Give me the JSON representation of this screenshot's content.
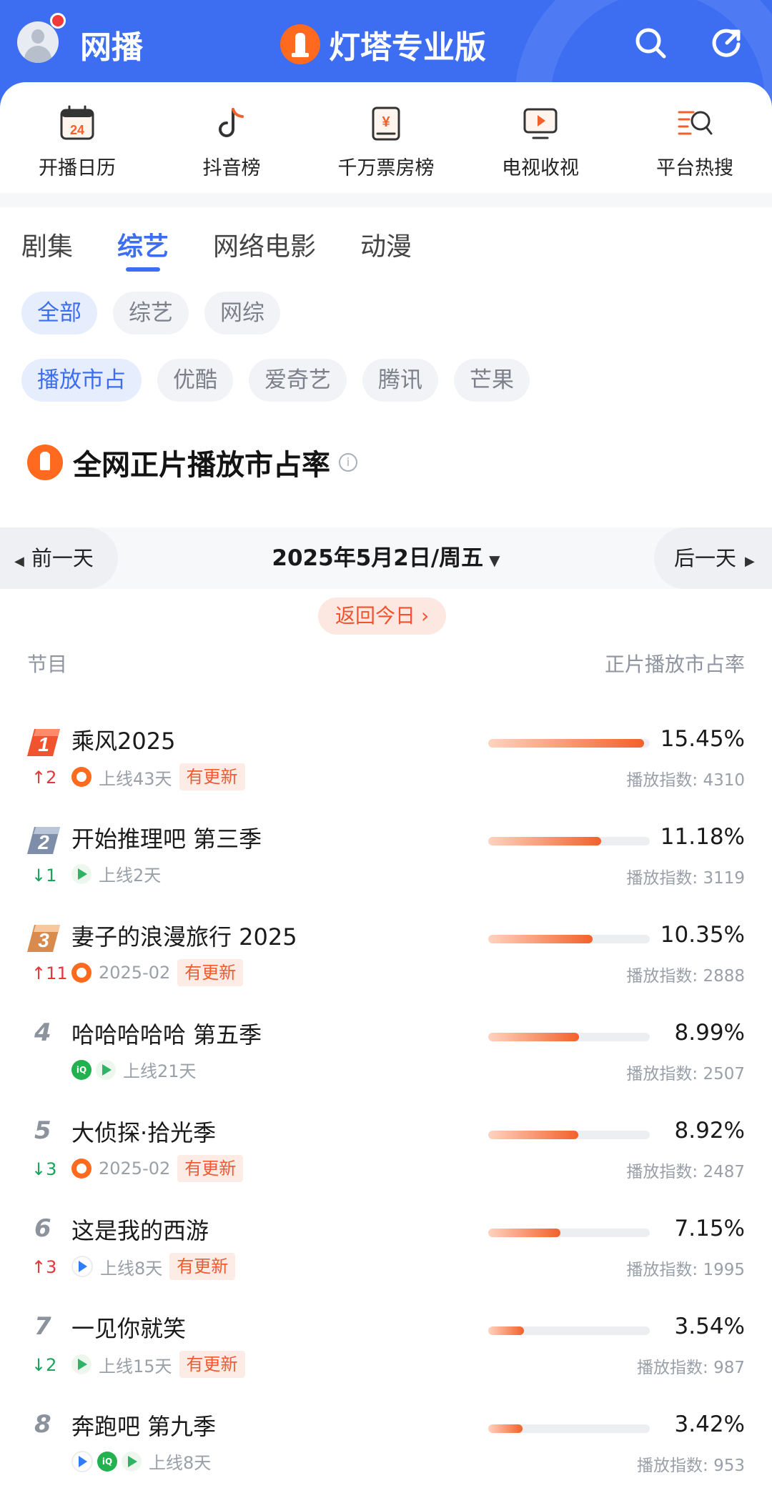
{
  "header": {
    "left_title": "网播",
    "app_name": "灯塔专业版",
    "icons": [
      "search-icon",
      "refresh-icon"
    ]
  },
  "quick_nav": [
    {
      "label": "开播日历",
      "icon": "calendar-icon",
      "day": "24"
    },
    {
      "label": "抖音榜",
      "icon": "tiktok-icon"
    },
    {
      "label": "千万票房榜",
      "icon": "ticket-icon",
      "symbol": "¥"
    },
    {
      "label": "电视收视",
      "icon": "tv-icon"
    },
    {
      "label": "平台热搜",
      "icon": "hot-search-icon"
    }
  ],
  "tabs": [
    "剧集",
    "综艺",
    "网络电影",
    "动漫"
  ],
  "active_tab": "综艺",
  "type_filters": [
    "全部",
    "综艺",
    "网综"
  ],
  "platform_filters": [
    "播放市占",
    "优酷",
    "爱奇艺",
    "腾讯",
    "芒果"
  ],
  "section": {
    "title": "全网正片播放市占率"
  },
  "date_nav": {
    "prev": "前一天",
    "date": "2025年5月2日/周五",
    "next": "后一天",
    "today": "返回今日"
  },
  "columns": {
    "program": "节目",
    "share": "正片播放市占率"
  },
  "colors": {
    "accent": "#3d6ef2",
    "orange": "#f2612b",
    "up": "#e4383a",
    "down": "#1aa35a"
  },
  "rows": [
    {
      "rank": "1",
      "change": "↑2",
      "dir": "up",
      "title": "乘风2025",
      "platforms": [
        "mango"
      ],
      "online": "上线43天",
      "updated": "有更新",
      "share": "15.45%",
      "share_value": 15.45,
      "index": "播放指数: 4310"
    },
    {
      "rank": "2",
      "change": "↓1",
      "dir": "down",
      "title": "开始推理吧 第三季",
      "platforms": [
        "tx"
      ],
      "online": "上线2天",
      "updated": "",
      "share": "11.18%",
      "share_value": 11.18,
      "index": "播放指数: 3119"
    },
    {
      "rank": "3",
      "change": "↑11",
      "dir": "up",
      "title": "妻子的浪漫旅行 2025",
      "platforms": [
        "mango"
      ],
      "online": "2025-02",
      "updated": "有更新",
      "share": "10.35%",
      "share_value": 10.35,
      "index": "播放指数: 2888"
    },
    {
      "rank": "4",
      "change": "",
      "dir": "",
      "title": "哈哈哈哈哈 第五季",
      "platforms": [
        "iq",
        "tx"
      ],
      "online": "上线21天",
      "updated": "",
      "share": "8.99%",
      "share_value": 8.99,
      "index": "播放指数: 2507"
    },
    {
      "rank": "5",
      "change": "↓3",
      "dir": "down",
      "title": "大侦探·拾光季",
      "platforms": [
        "mango"
      ],
      "online": "2025-02",
      "updated": "有更新",
      "share": "8.92%",
      "share_value": 8.92,
      "index": "播放指数: 2487"
    },
    {
      "rank": "6",
      "change": "↑3",
      "dir": "up",
      "title": "这是我的西游",
      "platforms": [
        "yk"
      ],
      "online": "上线8天",
      "updated": "有更新",
      "share": "7.15%",
      "share_value": 7.15,
      "index": "播放指数: 1995"
    },
    {
      "rank": "7",
      "change": "↓2",
      "dir": "down",
      "title": "一见你就笑",
      "platforms": [
        "tx"
      ],
      "online": "上线15天",
      "updated": "有更新",
      "share": "3.54%",
      "share_value": 3.54,
      "index": "播放指数: 987"
    },
    {
      "rank": "8",
      "change": "",
      "dir": "",
      "title": "奔跑吧 第九季",
      "platforms": [
        "yk",
        "iq",
        "tx"
      ],
      "online": "上线8天",
      "updated": "",
      "share": "3.42%",
      "share_value": 3.42,
      "index": "播放指数: 953"
    }
  ]
}
